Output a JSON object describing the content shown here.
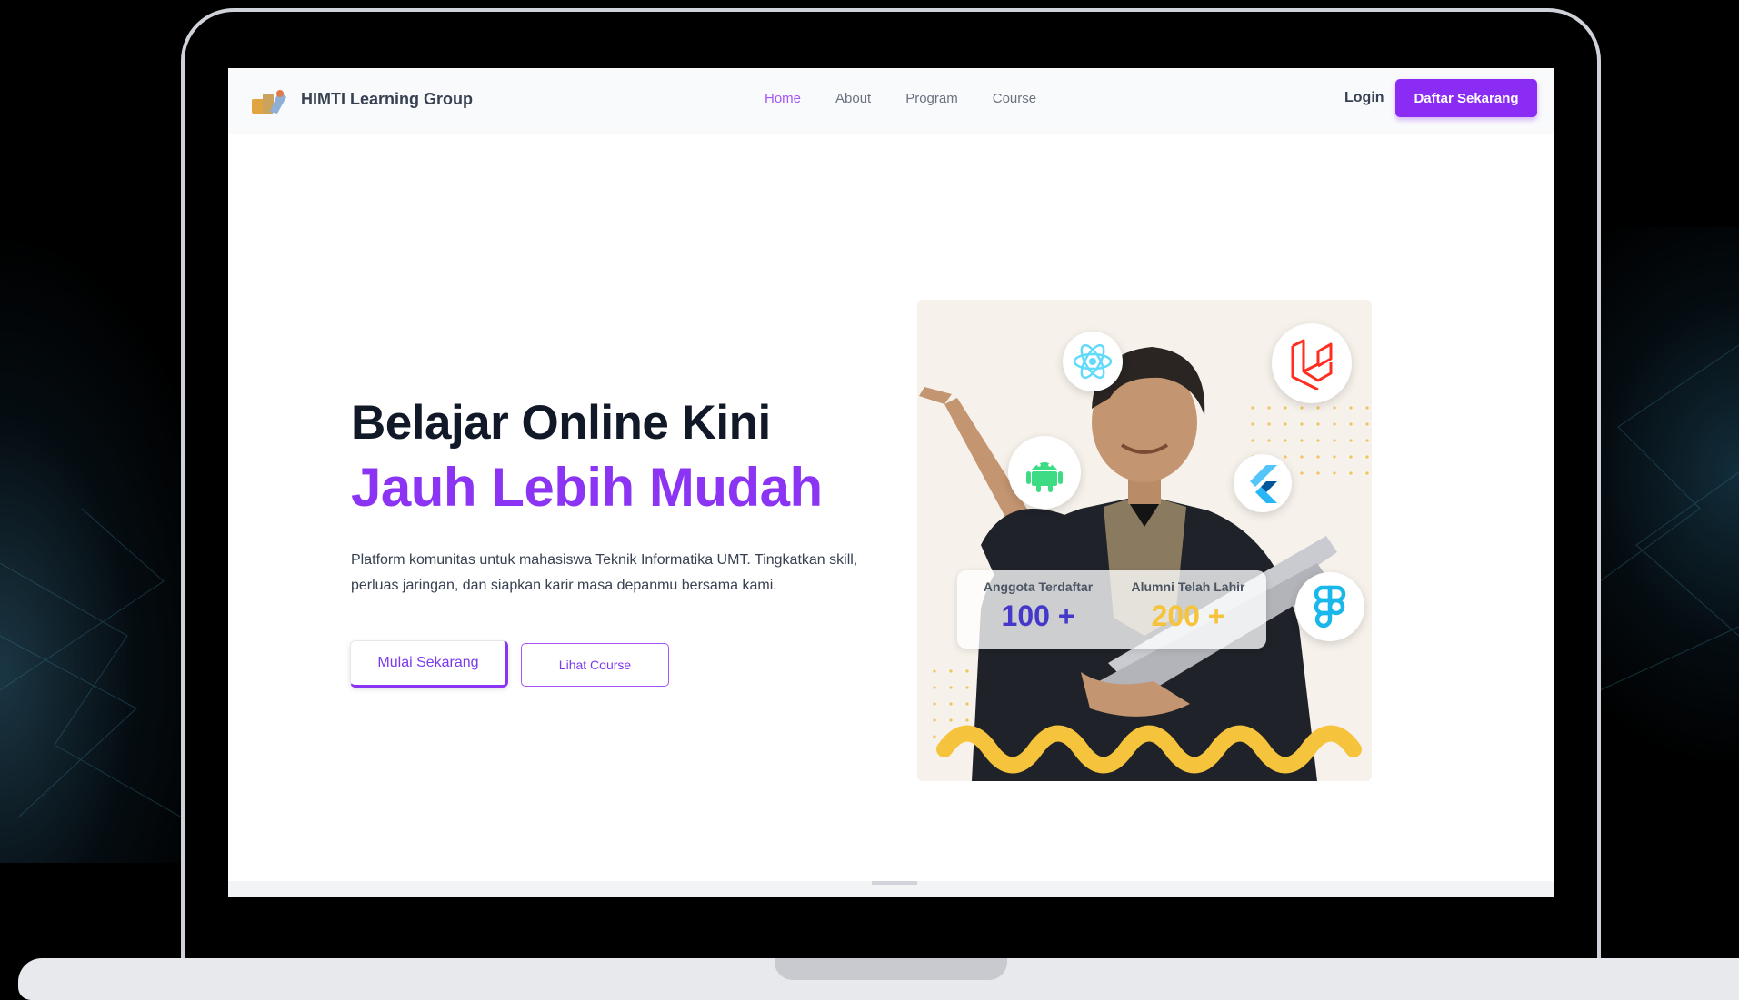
{
  "navbar": {
    "brand_name": "HIMTI Learning Group",
    "links": [
      {
        "label": "Home",
        "active": true
      },
      {
        "label": "About",
        "active": false
      },
      {
        "label": "Program",
        "active": false
      },
      {
        "label": "Course",
        "active": false
      }
    ],
    "login_label": "Login",
    "cta_label": "Daftar Sekarang"
  },
  "hero": {
    "title_line1": "Belajar Online Kini",
    "title_line2": "Jauh Lebih Mudah",
    "description": "Platform komunitas untuk mahasiswa Teknik Informatika UMT. Tingkatkan skill, perluas jaringan, dan siapkan karir masa depanmu bersama kami.",
    "primary_button": "Mulai Sekarang",
    "secondary_button": "Lihat Course"
  },
  "stats": [
    {
      "label": "Anggota Terdaftar",
      "value": "100 +"
    },
    {
      "label": "Alumni Telah Lahir",
      "value": "200 +"
    }
  ],
  "tech_icons": [
    "react-icon",
    "laravel-icon",
    "android-icon",
    "flutter-icon",
    "figma-icon"
  ],
  "colors": {
    "accent": "#8b34f3",
    "nav_active": "#a855f7",
    "stat_primary": "#4338ca",
    "stat_secondary": "#f6c43c",
    "squiggle": "#f6c43c"
  }
}
